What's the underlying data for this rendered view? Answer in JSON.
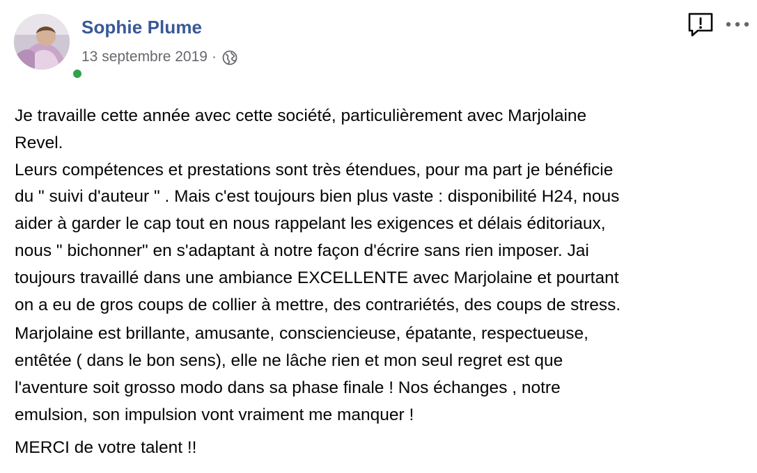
{
  "post": {
    "author": "Sophie Plume",
    "date": "13 septembre 2019",
    "separator": "·",
    "audience_icon": "globe-icon",
    "actions": {
      "report_icon": "report-icon",
      "more_icon": "more-options-icon"
    },
    "online_status_color": "#31a24c",
    "name_color": "#385898",
    "paragraphs": [
      "Je travaille cette année avec cette société, particulièrement avec Marjolaine\nRevel.\nLeurs compétences et prestations sont très étendues, pour ma part je bénéficie\ndu \" suivi d'auteur \" . Mais c'est toujours bien plus vaste : disponibilité H24, nous\naider à garder le cap tout en nous rappelant les exigences et délais éditoriaux,\nnous \" bichonner\" en s'adaptant à notre façon d'écrire sans rien imposer. Jai\ntoujours travaillé dans une ambiance EXCELLENTE avec Marjolaine et pourtant\non a eu de gros coups de collier à mettre, des contrariétés, des coups de stress.",
      "Marjolaine est brillante, amusante, consciencieuse, épatante, respectueuse,\nentêtée ( dans le bon sens), elle ne lâche rien et mon seul regret est que\nl'aventure soit grosso modo dans sa phase finale ! Nos échanges , notre\nemulsion, son impulsion vont vraiment me manquer !",
      "MERCI de votre talent !!"
    ]
  }
}
